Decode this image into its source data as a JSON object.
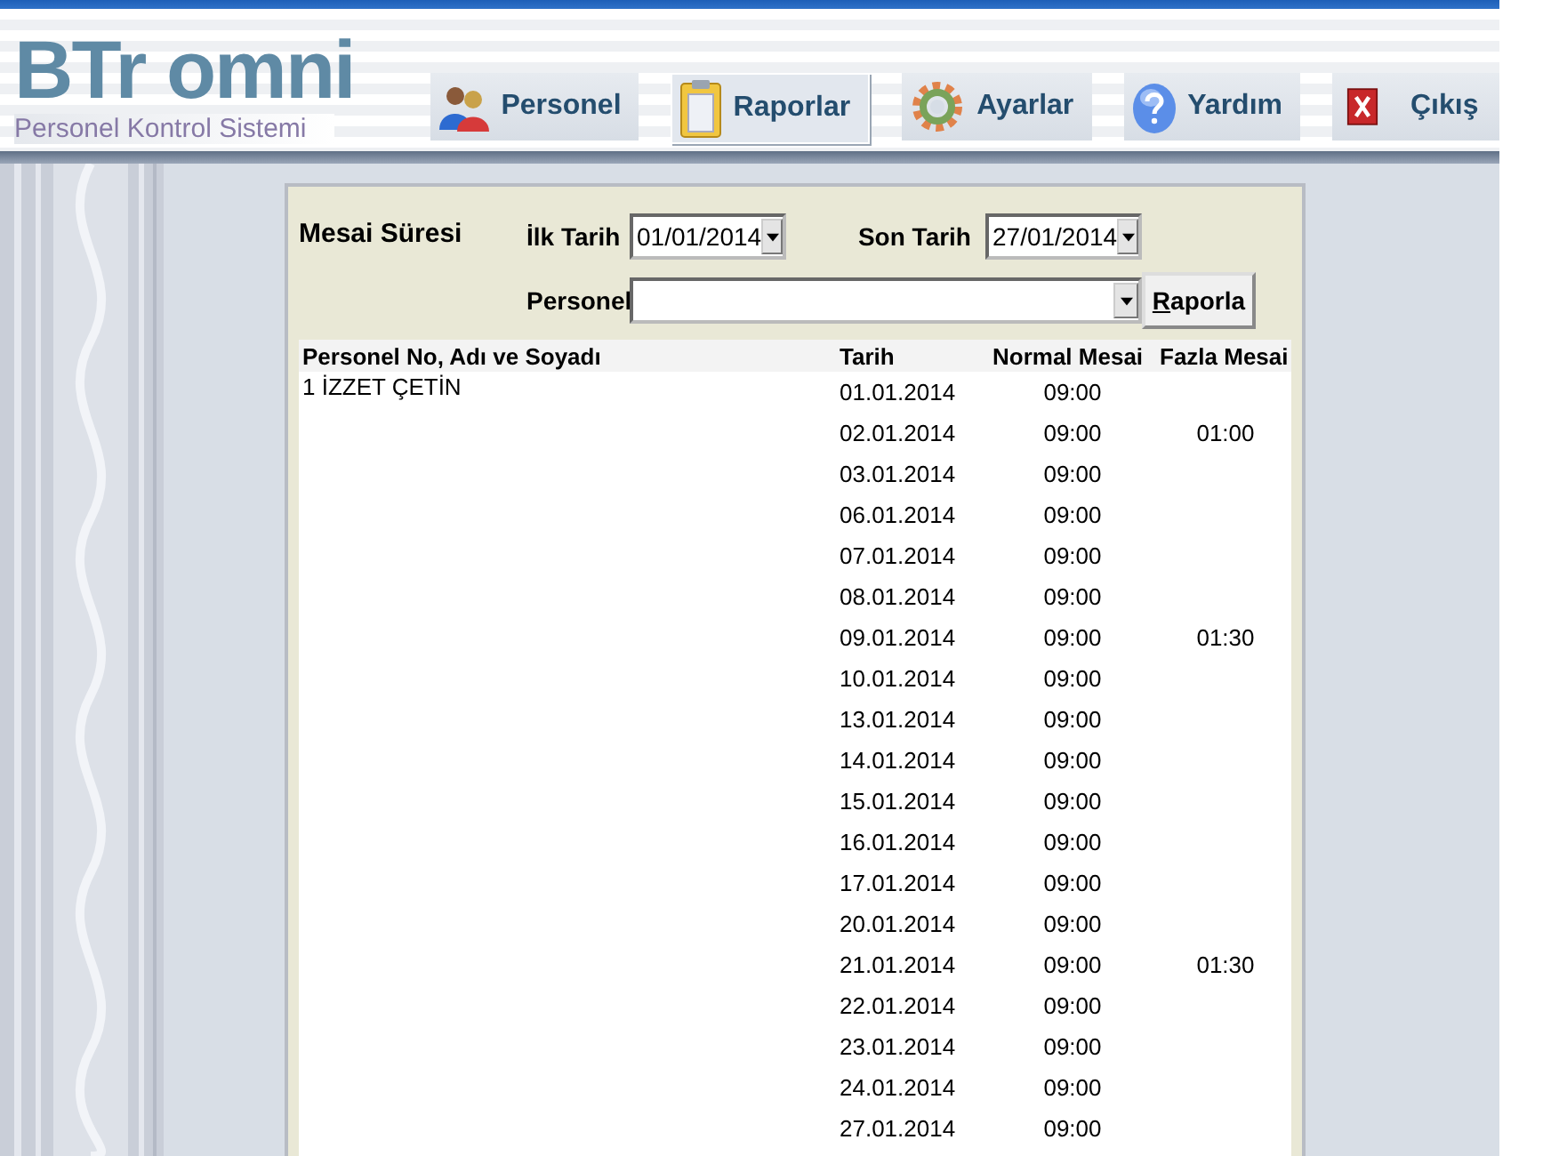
{
  "app": {
    "logo": "BTr omni",
    "subtitle": "Personel Kontrol Sistemi"
  },
  "nav": [
    {
      "label": "Personel",
      "kind": "people",
      "selected": false
    },
    {
      "label": "Raporlar",
      "kind": "clipboard",
      "selected": true
    },
    {
      "label": "Ayarlar",
      "kind": "gear",
      "selected": false
    },
    {
      "label": "Yardım",
      "kind": "help",
      "selected": false
    },
    {
      "label": "Çıkış",
      "kind": "exit",
      "selected": false
    }
  ],
  "filter": {
    "title": "Mesai Süresi",
    "start_label": "İlk Tarih",
    "start_value": "01/01/2014",
    "end_label": "Son Tarih",
    "end_value": "27/01/2014",
    "person_label": "Personel",
    "button": "Raporla"
  },
  "table": {
    "columns": [
      "Personel No, Adı ve Soyadı",
      "Tarih",
      "Normal Mesai",
      "Fazla Mesai"
    ],
    "groups": [
      {
        "person": "1 İZZET ÇETİN",
        "rows": [
          {
            "date": "01.01.2014",
            "normal": "09:00"
          },
          {
            "date": "02.01.2014",
            "normal": "09:00",
            "overtime": "01:00"
          },
          {
            "date": "03.01.2014",
            "normal": "09:00"
          },
          {
            "date": "06.01.2014",
            "normal": "09:00"
          },
          {
            "date": "07.01.2014",
            "normal": "09:00"
          },
          {
            "date": "08.01.2014",
            "normal": "09:00"
          },
          {
            "date": "09.01.2014",
            "normal": "09:00",
            "overtime": "01:30"
          },
          {
            "date": "10.01.2014",
            "normal": "09:00"
          },
          {
            "date": "13.01.2014",
            "normal": "09:00"
          },
          {
            "date": "14.01.2014",
            "normal": "09:00"
          },
          {
            "date": "15.01.2014",
            "normal": "09:00"
          },
          {
            "date": "16.01.2014",
            "normal": "09:00"
          },
          {
            "date": "17.01.2014",
            "normal": "09:00"
          },
          {
            "date": "20.01.2014",
            "normal": "09:00"
          },
          {
            "date": "21.01.2014",
            "normal": "09:00",
            "overtime": "01:30"
          },
          {
            "date": "22.01.2014",
            "normal": "09:00"
          },
          {
            "date": "23.01.2014",
            "normal": "09:00"
          },
          {
            "date": "24.01.2014",
            "normal": "09:00"
          },
          {
            "date": "27.01.2014",
            "normal": "09:00"
          }
        ]
      }
    ]
  }
}
